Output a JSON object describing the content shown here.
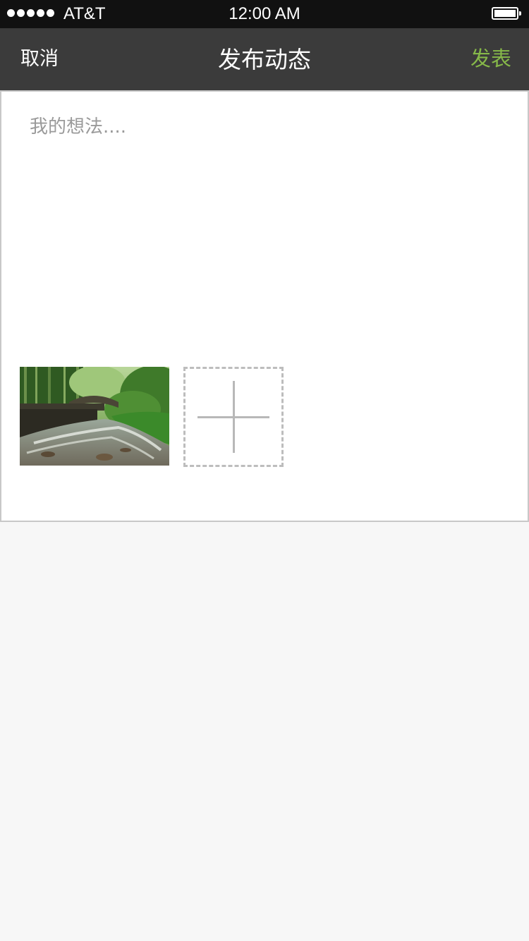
{
  "status_bar": {
    "carrier": "AT&T",
    "time": "12:00 AM",
    "signal_bars": 5,
    "battery_level": 1.0
  },
  "nav": {
    "cancel_label": "取消",
    "title": "发布动态",
    "publish_label": "发表",
    "publish_color": "#86b849"
  },
  "compose": {
    "placeholder": "我的想法....",
    "value": ""
  },
  "attachments": {
    "photos": [
      {
        "subject": "forest-stream-with-bridge"
      }
    ],
    "add_icon": "plus-icon"
  },
  "colors": {
    "status_bar_bg": "#111111",
    "nav_bg": "#3b3b3b",
    "page_bg": "#f7f7f7",
    "card_border": "#c8c8c8"
  }
}
